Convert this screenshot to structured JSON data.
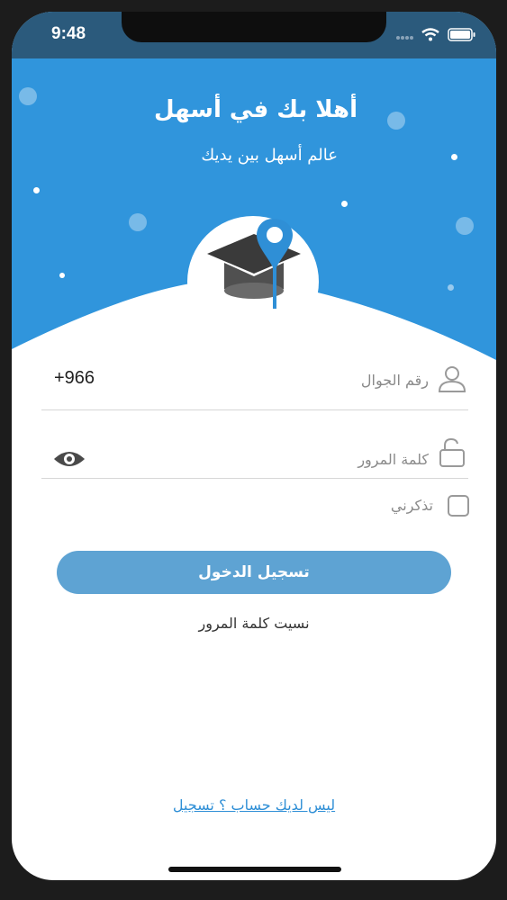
{
  "status_bar": {
    "time": "9:48"
  },
  "hero": {
    "title": "أهلا بك في أسهل",
    "subtitle": "عالم أسهل بين يديك"
  },
  "form": {
    "phone": {
      "label": "رقم الجوال",
      "prefix": "+966"
    },
    "password": {
      "label": "كلمة المرور"
    },
    "remember_label": "تذكرني",
    "login_label": "تسجيل الدخول",
    "forgot_label": "نسيت كلمة المرور",
    "signup_label": "ليس لديك حساب ؟ تسجيل"
  },
  "colors": {
    "hero_blue": "#3095dc",
    "button_blue": "#5ea3d3",
    "link_blue": "#2f8fd6"
  },
  "icons": [
    "wifi-icon",
    "battery-icon",
    "signal-icon",
    "graduation-cap-icon",
    "location-pin-icon",
    "user-icon",
    "lock-icon",
    "eye-icon"
  ]
}
